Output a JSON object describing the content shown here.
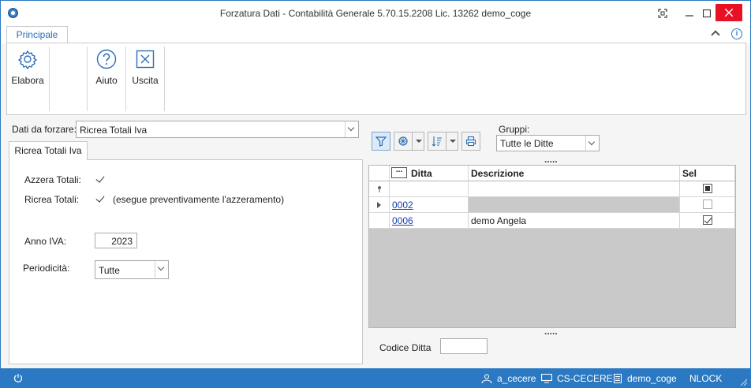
{
  "window": {
    "title": "Forzatura Dati - Contabilità Generale 5.70.15.2208 Lic. 13262 demo_coge"
  },
  "ribbon": {
    "tab": "Principale",
    "buttons": {
      "elabora": "Elabora",
      "aiuto": "Aiuto",
      "uscita": "Uscita"
    }
  },
  "left": {
    "dati_label": "Dati da forzare:",
    "dati_value": "Ricrea Totali Iva",
    "tab": "Ricrea Totali Iva",
    "azzera_label": "Azzera Totali:",
    "ricrea_label": "Ricrea Totali:",
    "ricrea_note": "(esegue preventivamente l'azzeramento)",
    "anno_label": "Anno IVA:",
    "anno_value": "2023",
    "periodicita_label": "Periodicità:",
    "periodicita_value": "Tutte"
  },
  "right": {
    "gruppi_label": "Gruppi:",
    "gruppi_value": "Tutte le Ditte",
    "grid": {
      "columns": [
        "Ditta",
        "Descrizione",
        "Sel"
      ],
      "rows": [
        {
          "ditta": "0002",
          "descrizione": "",
          "sel": false
        },
        {
          "ditta": "0006",
          "descrizione": "demo Angela",
          "sel": true
        }
      ]
    },
    "codice_label": "Codice Ditta",
    "codice_value": ""
  },
  "status": {
    "user": "a_cecere",
    "machine": "CS-CECERE",
    "db": "demo_coge",
    "lock": "NLOCK"
  },
  "colors": {
    "accent": "#2b79c2",
    "close": "#e81123"
  }
}
